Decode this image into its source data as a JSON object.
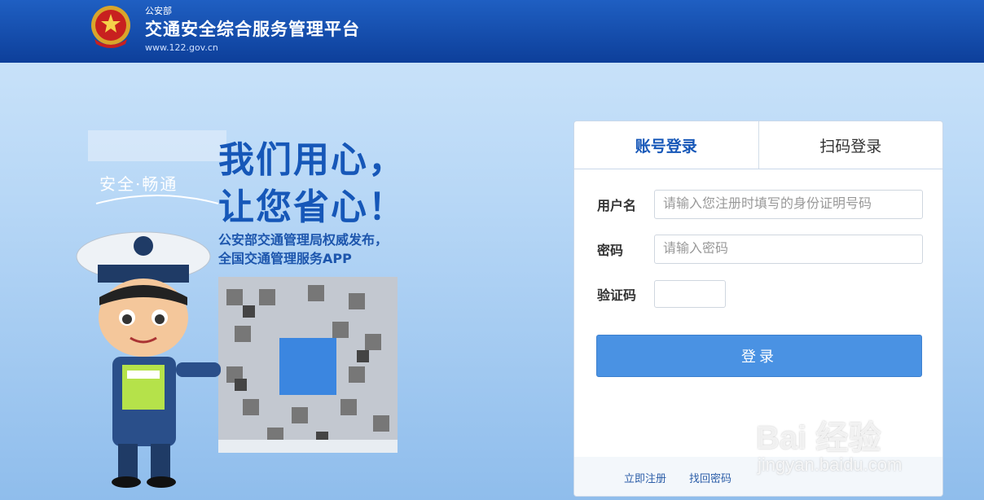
{
  "header": {
    "org": "公安部",
    "title": "交通安全综合服务管理平台",
    "url": "www.122.gov.cn"
  },
  "promo": {
    "badge": "安全·畅通",
    "headline1": "我们用心，",
    "headline2": "让您省心！",
    "sub1": "公安部交通管理局权威发布，",
    "sub2": "全国交通管理服务APP"
  },
  "login": {
    "tabs": [
      {
        "label": "账号登录",
        "active": true
      },
      {
        "label": "扫码登录",
        "active": false
      }
    ],
    "username_label": "用户名",
    "username_placeholder": "请输入您注册时填写的身份证明号码",
    "password_label": "密码",
    "password_placeholder": "请输入密码",
    "captcha_label": "验证码",
    "submit_label": "登录",
    "register_link": "立即注册",
    "recover_link": "找回密码"
  },
  "watermark": {
    "brand": "Bai 经验",
    "domain": "jingyan.baidu.com"
  },
  "colors": {
    "header": "#0d3f9a",
    "accent": "#1657b8",
    "button": "#4a92e3"
  }
}
